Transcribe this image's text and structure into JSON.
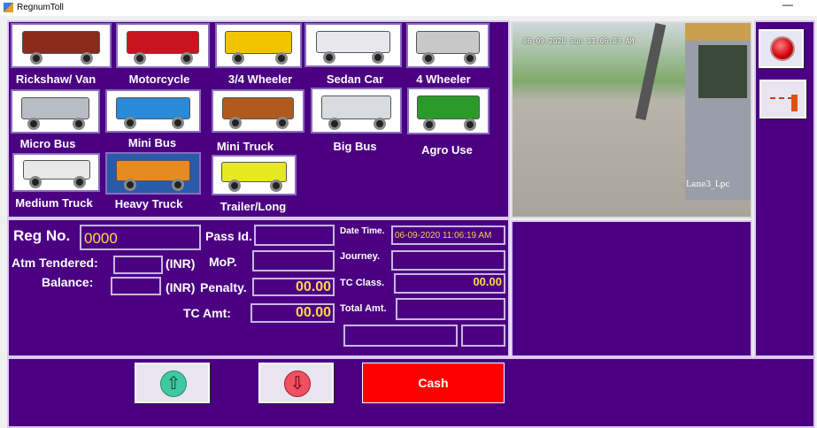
{
  "window": {
    "title": "RegnumToll",
    "minimize": "—"
  },
  "vehicles": [
    {
      "label": "Rickshaw/ Van",
      "color": "#8a2a1a"
    },
    {
      "label": "Motorcycle",
      "color": "#c8141e"
    },
    {
      "label": "3/4 Wheeler",
      "color": "#f2c400"
    },
    {
      "label": "Sedan Car",
      "color": "#e8e8ec"
    },
    {
      "label": "4 Wheeler",
      "color": "#c8c8c8"
    },
    {
      "label": "Micro Bus",
      "color": "#b8bcc4"
    },
    {
      "label": "Mini Bus",
      "color": "#2a8ad8"
    },
    {
      "label": "Mini Truck",
      "color": "#b05a20"
    },
    {
      "label": "Big Bus",
      "color": "#d8dce0"
    },
    {
      "label": "Agro Use",
      "color": "#2a9a2a"
    },
    {
      "label": "Medium Truck",
      "color": "#e8e8e8"
    },
    {
      "label": "Heavy Truck",
      "color": "#e88a20"
    },
    {
      "label": "Trailer/Long",
      "color": "#e8e820"
    }
  ],
  "camera": {
    "timestamp": "06-09-2020 Sun 11:06:03 AM",
    "lane": "Lane3_Lpc"
  },
  "form": {
    "reg_no_label": "Reg No.",
    "reg_no": "0000",
    "pass_id_label": "Pass Id.",
    "pass_id": "",
    "atm_tendered_label": "Atm Tendered:",
    "atm_tendered": "",
    "inr1": "(INR)",
    "mop_label": "MoP.",
    "mop": "",
    "balance_label": "Balance:",
    "balance": "",
    "inr2": "(INR)",
    "penalty_label": "Penalty.",
    "penalty": "00.00",
    "tc_amt_label": "TC Amt:",
    "tc_amt": "00.00",
    "datetime_label": "Date Time.",
    "datetime": "06-09-2020  11:06:19 AM",
    "journey_label": "Journey.",
    "journey": "",
    "tc_class_label": "TC Class.",
    "tc_class": "00.00",
    "total_amt_label": "Total Amt.",
    "total_amt": "",
    "extra1": "",
    "extra2": ""
  },
  "buttons": {
    "cash": "Cash",
    "up_icon": "arrow-up-icon",
    "down_icon": "arrow-down-icon"
  },
  "colors": {
    "panel": "#4b0082",
    "cash": "#ff0000",
    "value": "#ffd84a"
  }
}
